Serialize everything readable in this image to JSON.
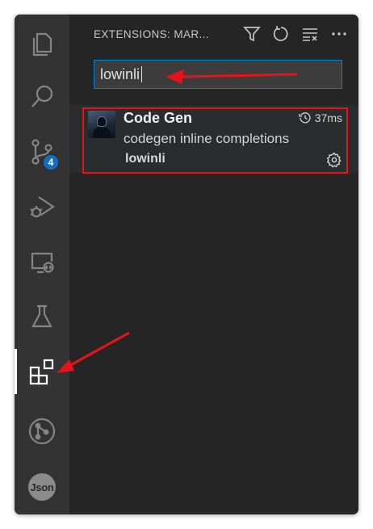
{
  "header": {
    "title": "EXTENSIONS: MAR..."
  },
  "activity_bar": {
    "items": [
      {
        "name": "explorer-icon"
      },
      {
        "name": "search-icon"
      },
      {
        "name": "source-control-icon",
        "badge": "4"
      },
      {
        "name": "run-debug-icon"
      },
      {
        "name": "remote-explorer-icon"
      },
      {
        "name": "testing-icon"
      },
      {
        "name": "extensions-icon",
        "active": true
      },
      {
        "name": "git-graph-icon"
      },
      {
        "name": "json-icon",
        "label": "Json"
      }
    ]
  },
  "header_actions": [
    "filter-icon",
    "refresh-icon",
    "clear-icon",
    "more-icon"
  ],
  "search": {
    "value": "lowinli"
  },
  "extension": {
    "name": "Code Gen",
    "description": "codegen inline completions",
    "publisher": "lowinli",
    "activation_time": "37ms"
  },
  "colors": {
    "accent": "#007fd4",
    "badge": "#0e70c0",
    "annotation": "#e8131a"
  }
}
